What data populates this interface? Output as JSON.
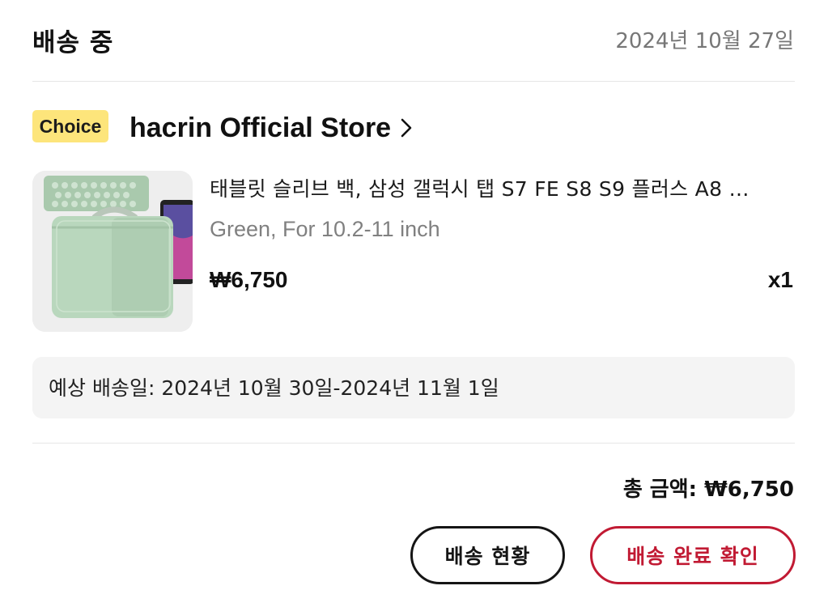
{
  "header": {
    "status": "배송 중",
    "date": "2024년 10월 27일"
  },
  "store": {
    "badge": "Choice",
    "name": "hacrin Official Store",
    "badge_color": "#fde57b"
  },
  "product": {
    "name": "태블릿 슬리브 백, 삼성 갤럭시 탭 S7 FE S8 S9 플러스 A8 …",
    "variant": "Green, For 10.2-11 inch",
    "price": "₩6,750",
    "quantity": "x1",
    "thumbnail_color": "#b9d7bd"
  },
  "delivery": {
    "estimate": "예상 배송일: 2024년 10월 30일-2024년 11월 1일"
  },
  "summary": {
    "total": "총 금액: ₩6,750"
  },
  "actions": {
    "track_label": "배송 현황",
    "confirm_label": "배송 완료 확인",
    "confirm_color": "#c11a33"
  }
}
